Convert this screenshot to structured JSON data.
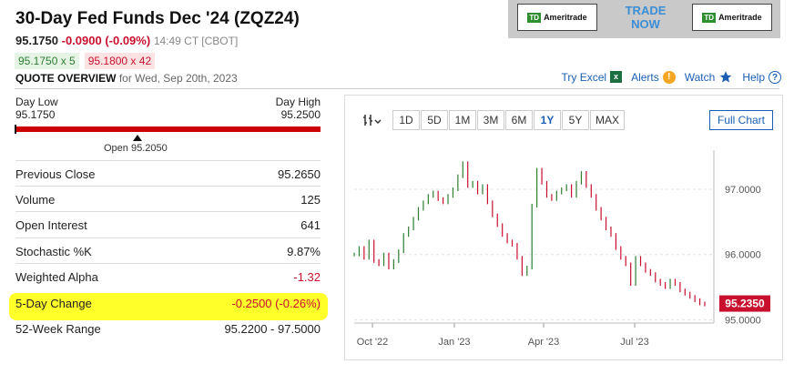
{
  "header": {
    "title": "30-Day Fed Funds Dec '24 (ZQZ24)",
    "last": "95.1750",
    "change": "-0.0900 (-0.09%)",
    "time": "14:49 CT [CBOT]",
    "bid": "95.1750 x 5",
    "ask": "95.1800 x 42",
    "quote_overview_label": "QUOTE OVERVIEW",
    "quote_overview_date": "for Wed, Sep 20th, 2023"
  },
  "ad": {
    "logo_left": "Ameritrade",
    "logo_right": "Ameritrade",
    "td": "TD",
    "trade": "TRADE",
    "now": "NOW"
  },
  "links": {
    "try_excel": "Try Excel",
    "alerts": "Alerts",
    "watch": "Watch",
    "help": "Help"
  },
  "range": {
    "day_low_label": "Day Low",
    "day_low": "95.1750",
    "day_high_label": "Day High",
    "day_high": "95.2500",
    "open_label": "Open 95.2050"
  },
  "stats": [
    {
      "label": "Previous Close",
      "value": "95.2650"
    },
    {
      "label": "Volume",
      "value": "125"
    },
    {
      "label": "Open Interest",
      "value": "641"
    },
    {
      "label": "Stochastic %K",
      "value": "9.87%"
    },
    {
      "label": "Weighted Alpha",
      "value": "-1.32"
    },
    {
      "label": "5-Day Change",
      "value": "-0.2500 (-0.26%)"
    },
    {
      "label": "52-Week Range",
      "value": "95.2200 - 97.5000"
    }
  ],
  "chart_toolbar": {
    "buttons": [
      "1D",
      "5D",
      "1M",
      "3M",
      "6M",
      "1Y",
      "5Y",
      "MAX"
    ],
    "selected": "1Y",
    "full_chart": "Full Chart"
  },
  "colors": {
    "up": "#2e7d32",
    "down": "#c8102e",
    "highlight": "#ffff2a"
  },
  "chart_data": {
    "type": "line",
    "x_tick_labels": [
      "Oct '22",
      "Jan '23",
      "Apr '23",
      "Jul '23"
    ],
    "y_tick_labels": [
      "97.0000",
      "96.0000",
      "95.0000"
    ],
    "ylim": [
      94.95,
      97.6
    ],
    "last_price_label": "95.2350",
    "series": [
      {
        "values": [
          96.0,
          96.1,
          95.95,
          96.2,
          95.9,
          95.85,
          96.0,
          95.8,
          95.9,
          96.05,
          96.3,
          96.4,
          96.55,
          96.7,
          96.8,
          96.9,
          96.95,
          96.85,
          96.8,
          96.9,
          97.0,
          97.2,
          97.4,
          97.05,
          97.1,
          96.95,
          97.05,
          96.8,
          96.6,
          96.45,
          96.3,
          96.2,
          96.15,
          95.95,
          95.7,
          95.8,
          96.75,
          97.3,
          97.1,
          96.9,
          96.85,
          96.95,
          97.0,
          97.05,
          96.9,
          97.1,
          97.25,
          97.05,
          96.9,
          96.7,
          96.55,
          96.4,
          96.3,
          96.1,
          95.95,
          95.85,
          95.55,
          95.95,
          95.85,
          95.75,
          95.7,
          95.6,
          95.55,
          95.5,
          95.6,
          95.55,
          95.45,
          95.4,
          95.35,
          95.3,
          95.25,
          95.235
        ]
      }
    ]
  }
}
